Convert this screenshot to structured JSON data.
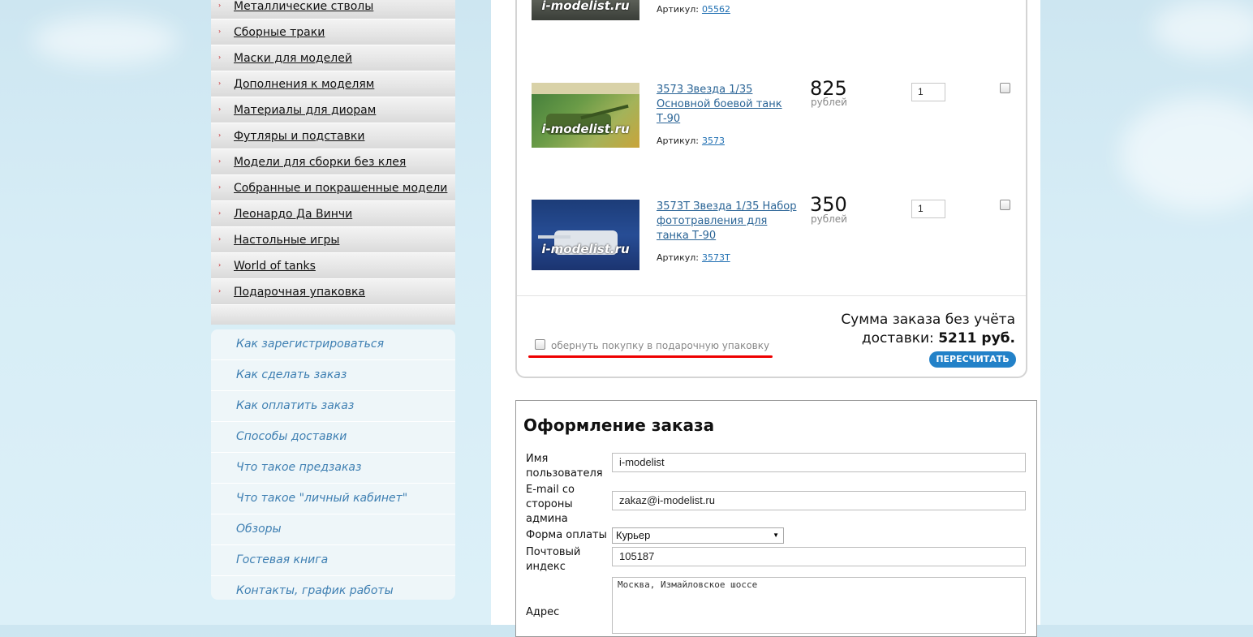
{
  "categories": [
    "Металлические стволы",
    "Сборные траки",
    "Маски для моделей",
    "Дополнения к моделям",
    "Материалы для диорам",
    "Футляры и подставки",
    "Модели для сборки без клея",
    "Собранные и покрашенные модели",
    "Леонардо Да Винчи",
    "Настольные игры",
    "World of tanks",
    "Подарочная упаковка"
  ],
  "help_links": [
    "Как зарегистрироваться",
    "Как сделать заказ",
    "Как оплатить заказ",
    "Способы доставки",
    "Что такое предзаказ",
    "Что такое \"личный кабинет\"",
    "Обзоры",
    "Гостевая книга",
    "Контакты, график работы"
  ],
  "cart": {
    "items": [
      {
        "title": "",
        "sku_label": "Артикул:",
        "sku": "05562",
        "watermark": "i-modelist.ru"
      },
      {
        "title": "3573 Звезда 1/35 Основной боевой танк Т-90",
        "sku_label": "Артикул:",
        "sku": "3573",
        "price": "825",
        "currency": "рублей",
        "qty": "1",
        "watermark": "i-modelist.ru"
      },
      {
        "title": "3573Т Звезда 1/35 Набор фототравления для танка Т-90",
        "sku_label": "Артикул:",
        "sku": "3573Т",
        "price": "350",
        "currency": "рублей",
        "qty": "1",
        "watermark": "i-modelist.ru"
      }
    ],
    "gift_wrap_label": "обернуть покупку в подарочную упаковку",
    "sum_line1": "Сумма заказа без учёта",
    "sum_line2_prefix": "доставки:",
    "sum_value": "5211 руб.",
    "recalc_button": "ПЕРЕСЧИТАТЬ",
    "accent_color": "#2281c8",
    "highlight_color": "#ee0000"
  },
  "order_form": {
    "title": "Оформление заказа",
    "username_label": "Имя пользователя",
    "username_value": "i-modelist",
    "email_label": "E-mail со стороны админа",
    "email_value": "zakaz@i-modelist.ru",
    "payment_label": "Форма оплаты",
    "payment_value": "Курьер",
    "zip_label": "Почтовый индекс",
    "zip_value": "105187",
    "address_label": "Адрес",
    "address_value": "Москва, Измайловское шоссе"
  }
}
